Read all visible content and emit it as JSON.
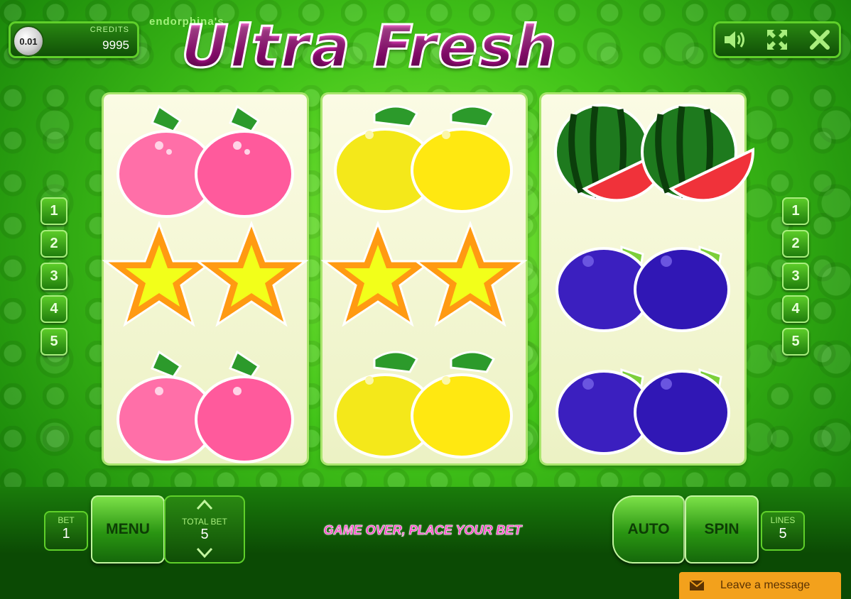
{
  "brand": "endorphina's",
  "title": "Ultra Fresh",
  "credits": {
    "coin_value": "0.01",
    "label": "CREDITS",
    "value": "9995"
  },
  "top_controls": {
    "icons": [
      "sound-icon",
      "fullscreen-icon",
      "close-icon"
    ]
  },
  "reels": [
    [
      "raspberry",
      "star",
      "raspberry"
    ],
    [
      "lemon",
      "star",
      "lemon"
    ],
    [
      "watermelon",
      "grapes",
      "grapes"
    ]
  ],
  "line_buttons_left": [
    "1",
    "2",
    "3",
    "4",
    "5"
  ],
  "line_buttons_right": [
    "1",
    "2",
    "3",
    "4",
    "5"
  ],
  "bottom": {
    "bet": {
      "label": "BET",
      "value": "1"
    },
    "menu_label": "MENU",
    "total_bet": {
      "label": "TOTAL BET",
      "value": "5"
    },
    "status": "GAME OVER, PLACE YOUR BET",
    "auto_label": "AUTO",
    "spin_label": "SPIN",
    "lines": {
      "label": "LINES",
      "value": "5"
    }
  },
  "chat": {
    "label": "Leave a message",
    "icon": "envelope-icon"
  },
  "colors": {
    "title": "#c3139d",
    "status": "#ff3fc6",
    "chat": "#f3a11c"
  }
}
